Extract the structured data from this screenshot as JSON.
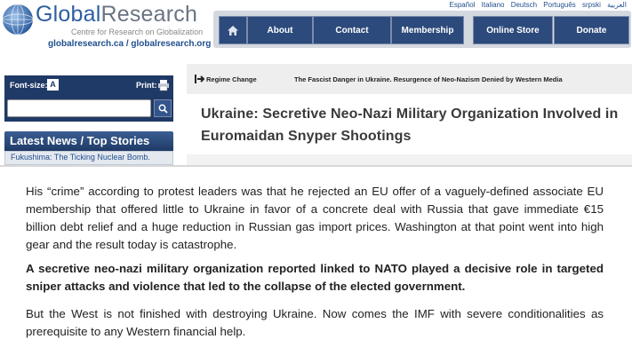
{
  "brand": {
    "name_part1": "Global",
    "name_part2": "Research",
    "tagline": "Centre for Research on Globalization",
    "sites": "globalresearch.ca / globalresearch.org"
  },
  "languages": [
    "Español",
    "Italiano",
    "Deutsch",
    "Português",
    "srpski",
    "العربية"
  ],
  "nav": {
    "items": [
      "About",
      "Contact",
      "Membership",
      "Online Store",
      "Donate"
    ]
  },
  "sidebar": {
    "font_size_label": "Font-size:",
    "font_size_icon": "A",
    "print_label": "Print:",
    "search_placeholder": "",
    "latest_heading": "Latest News / Top Stories",
    "latest_items": [
      "Fukushima: The Ticking Nuclear Bomb."
    ]
  },
  "ticker": {
    "item1": "Regime Change",
    "item2": "The Fascist Danger in Ukraine. Resurgence of Neo-Nazism Denied by Western Media"
  },
  "article": {
    "title": "Ukraine: Secretive Neo-Nazi Military Organization Involved in Euromaidan Snyper Shootings",
    "paragraphs": [
      "His “crime” according to protest leaders was that he rejected an EU offer of a vaguely-defined associate EU membership that offered little to Ukraine in favor of a concrete deal with Russia that gave immediate €15 billion debt relief and a huge reduction in Russian gas import prices. Washington at that point went into high gear and the result today is catastrophe.",
      "A secretive neo-nazi military organization reported linked to NATO played a decisive role in targeted sniper attacks and violence that led to the collapse of the elected government.",
      "But the West is not finished with destroying Ukraine. Now comes the IMF with severe conditionalities as prerequisite to any Western financial help."
    ]
  },
  "colors": {
    "nav_blue": "#2c4a7b",
    "sidebar_blue": "#1f3a66",
    "brand_blue": "#2d5ea1",
    "link_blue": "#1f4f8f"
  }
}
